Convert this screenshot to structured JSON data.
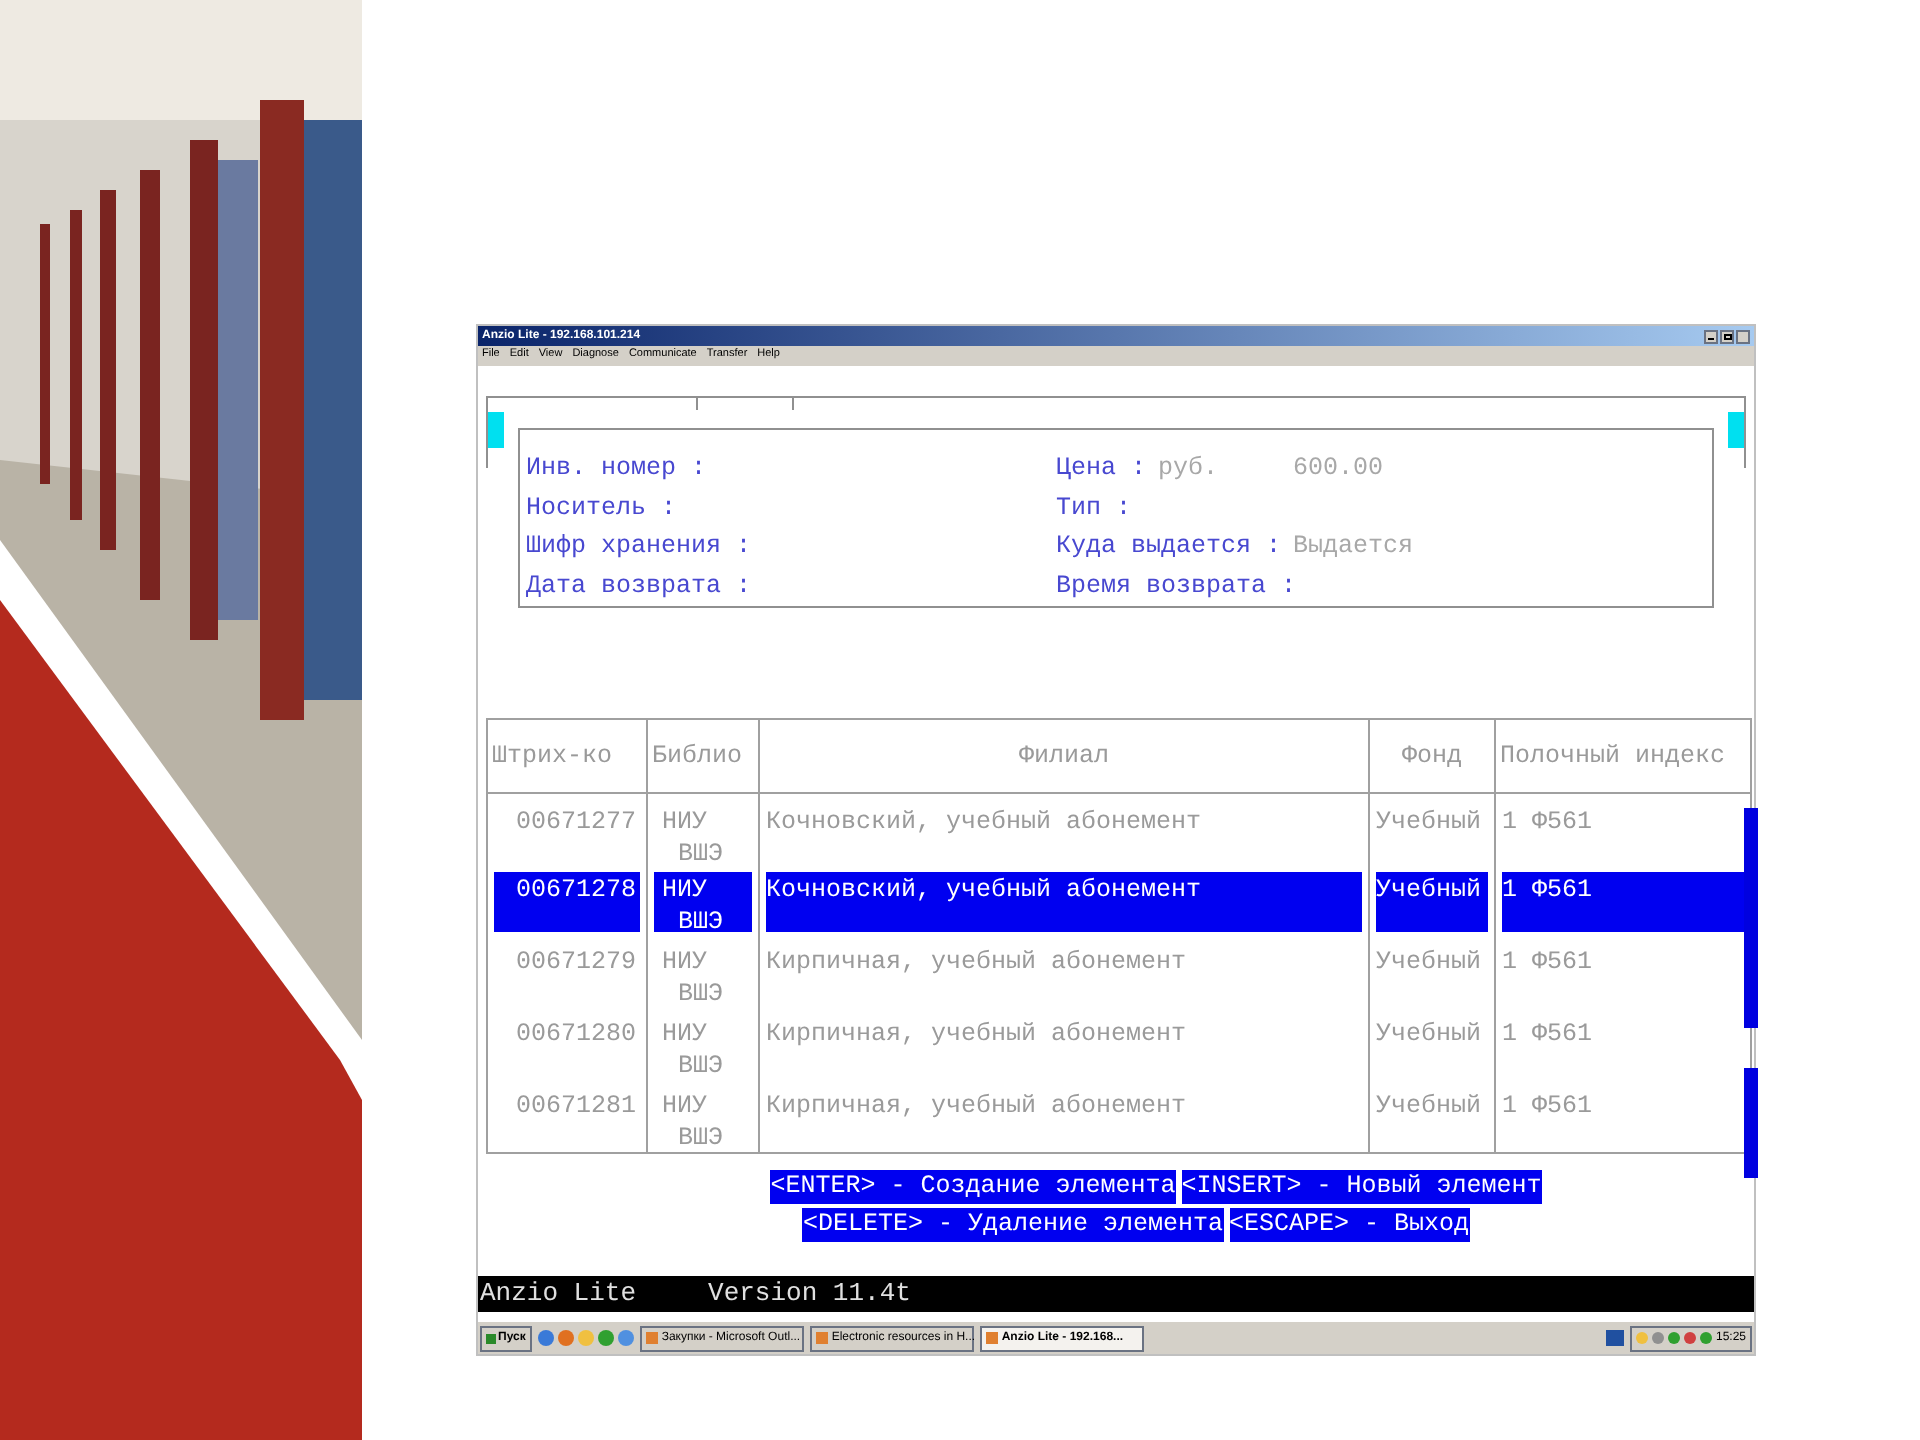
{
  "window": {
    "title": "Anzio Lite - 192.168.101.214"
  },
  "menu": [
    "File",
    "Edit",
    "View",
    "Diagnose",
    "Communicate",
    "Transfer",
    "Help"
  ],
  "fields": [
    {
      "label": "Инв. номер :"
    },
    {
      "label": "Цена :",
      "value": "руб.     600.00"
    },
    {
      "label": "Носитель :"
    },
    {
      "label": "Тип :"
    },
    {
      "label": "Шифр хранения :"
    },
    {
      "label": "Куда выдается :",
      "value": "Выдается"
    },
    {
      "label": "Дата возврата :"
    },
    {
      "label": "Время возврата :"
    }
  ],
  "table": {
    "columns": [
      "Штрих-ко",
      "Библио",
      "Филиал",
      "Фонд",
      "Полочный индекс"
    ],
    "rows": [
      {
        "cells": [
          "00671277",
          "НИУ ВШЭ",
          "Кочновский, учебный абонемент",
          "Учебный",
          "1 Ф561"
        ],
        "selected": false
      },
      {
        "cells": [
          "00671278",
          "НИУ ВШЭ",
          "Кочновский, учебный абонемент",
          "Учебный",
          "1 Ф561"
        ],
        "selected": true
      },
      {
        "cells": [
          "00671279",
          "НИУ ВШЭ",
          "Кирпичная, учебный абонемент",
          "Учебный",
          "1 Ф561"
        ],
        "selected": false
      },
      {
        "cells": [
          "00671280",
          "НИУ ВШЭ",
          "Кирпичная, учебный абонемент",
          "Учебный",
          "1 Ф561"
        ],
        "selected": false
      },
      {
        "cells": [
          "00671281",
          "НИУ ВШЭ",
          "Кирпичная, учебный абонемент",
          "Учебный",
          "1 Ф561"
        ],
        "selected": false
      }
    ]
  },
  "hints": [
    [
      "<ENTER> - Создание элемента",
      "<INSERT> - Новый элемент"
    ],
    [
      "<DELETE> - Удаление элемента",
      "<ESCAPE> - Выход"
    ]
  ],
  "status_bar": {
    "app": "Anzio Lite",
    "version": "Version 11.4t"
  },
  "taskbar": {
    "start": "Пуск",
    "tasks": [
      {
        "label": "Закупки - Microsoft Outl...",
        "selected": false
      },
      {
        "label": "Electronic resources in H...",
        "selected": false
      },
      {
        "label": "Anzio Lite - 192.168...",
        "selected": true
      }
    ],
    "clock": "15:25"
  }
}
